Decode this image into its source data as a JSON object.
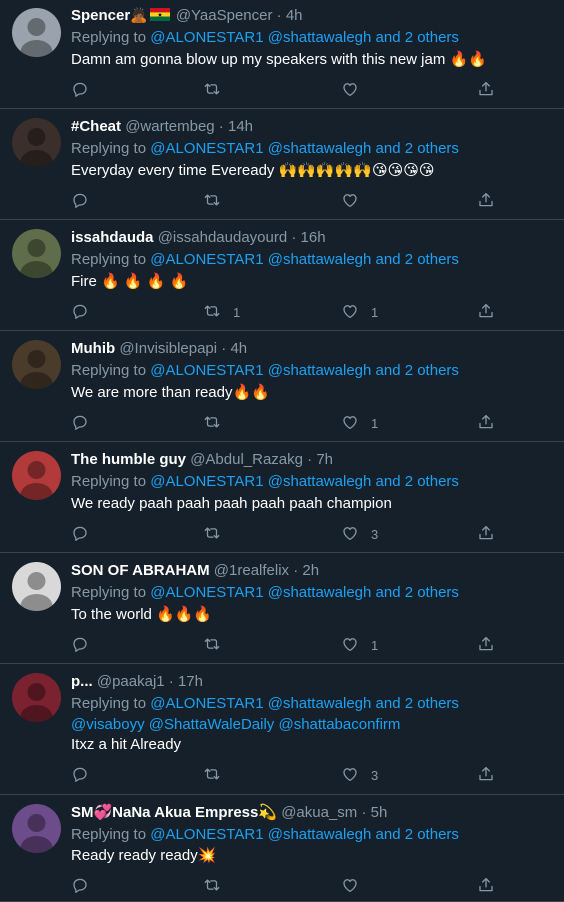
{
  "reply_label": "Replying to",
  "mentions_line": [
    "@ALONESTAR1",
    "@shattawalegh",
    "and 2 others"
  ],
  "tweets": [
    {
      "name": "Spencer",
      "name_suffix": "🙇🏾",
      "handle": "@YaaSpencer",
      "time": "4h",
      "extra_mentions": "",
      "text": "Damn am gonna blow up my speakers with this new jam 🔥🔥",
      "replies": "",
      "retweets": "",
      "likes": ""
    },
    {
      "name": "#Cheat",
      "name_suffix": "",
      "handle": "@wartembeg",
      "time": "14h",
      "extra_mentions": "",
      "text": "Everyday every time Eveready 🙌🙌🙌🙌🙌😘😘😘😘",
      "replies": "",
      "retweets": "",
      "likes": ""
    },
    {
      "name": "issahdauda",
      "name_suffix": "",
      "handle": "@issahdaudayourd",
      "time": "16h",
      "extra_mentions": "",
      "text": "Fire 🔥 🔥 🔥 🔥",
      "replies": "",
      "retweets": "1",
      "likes": "1"
    },
    {
      "name": "Muhib",
      "name_suffix": "",
      "handle": "@Invisiblepapi",
      "time": "4h",
      "extra_mentions": "",
      "text": "We are more than ready🔥🔥",
      "replies": "",
      "retweets": "",
      "likes": "1"
    },
    {
      "name": "The humble guy",
      "name_suffix": "",
      "handle": "@Abdul_Razakg",
      "time": "7h",
      "extra_mentions": "",
      "text": "We ready paah paah paah paah paah champion",
      "replies": "",
      "retweets": "",
      "likes": "3"
    },
    {
      "name": "SON OF ABRAHAM",
      "name_suffix": "",
      "handle": "@1realfelix",
      "time": "2h",
      "extra_mentions": "",
      "text": "To the world 🔥🔥🔥",
      "replies": "",
      "retweets": "",
      "likes": "1"
    },
    {
      "name": "p...",
      "name_suffix": "",
      "handle": "@paakaj1",
      "time": "17h",
      "extra_mentions": "@visaboyy @ShattaWaleDaily @shattabaconfirm",
      "text": "Itxz a hit Already",
      "replies": "",
      "retweets": "",
      "likes": "3"
    },
    {
      "name": "SM💞NaNa Akua Empress💫",
      "name_suffix": "",
      "handle": "@akua_sm",
      "time": "5h",
      "extra_mentions": "",
      "text": "Ready ready ready💥",
      "replies": "",
      "retweets": "",
      "likes": ""
    }
  ],
  "colors": {
    "background": "#15202b",
    "divider": "#38444d",
    "secondary_text": "#8899a6",
    "link": "#1da1f2"
  },
  "icons": [
    "reply-icon",
    "retweet-icon",
    "like-icon",
    "share-icon",
    "ghana-flag-icon"
  ]
}
